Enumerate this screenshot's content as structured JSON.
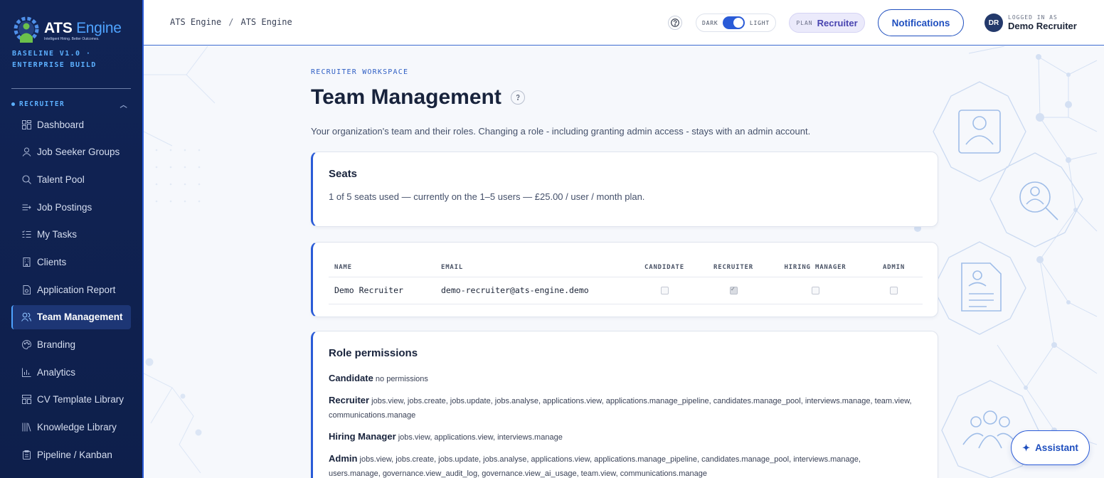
{
  "brand": {
    "name_main": "ATS",
    "name_accent": "Engine",
    "tagline": "Intelligent Hiring. Better Outcomes.",
    "build_line1": "BASELINE V1.0 ·",
    "build_line2": "ENTERPRISE BUILD"
  },
  "sidebar": {
    "section": "RECRUITER",
    "items": [
      {
        "label": "Dashboard",
        "icon": "dashboard-icon"
      },
      {
        "label": "Job Seeker Groups",
        "icon": "user-icon"
      },
      {
        "label": "Talent Pool",
        "icon": "search-icon"
      },
      {
        "label": "Job Postings",
        "icon": "list-arrow-icon"
      },
      {
        "label": "My Tasks",
        "icon": "checklist-icon"
      },
      {
        "label": "Clients",
        "icon": "building-icon"
      },
      {
        "label": "Application Report",
        "icon": "report-icon"
      },
      {
        "label": "Team Management",
        "icon": "team-icon",
        "active": true
      },
      {
        "label": "Branding",
        "icon": "palette-icon"
      },
      {
        "label": "Analytics",
        "icon": "bar-chart-icon"
      },
      {
        "label": "CV Template Library",
        "icon": "template-icon"
      },
      {
        "label": "Knowledge Library",
        "icon": "library-icon"
      },
      {
        "label": "Pipeline / Kanban",
        "icon": "clipboard-icon"
      }
    ]
  },
  "topbar": {
    "breadcrumb": [
      "ATS Engine",
      "ATS Engine"
    ],
    "theme_dark": "DARK",
    "theme_light": "LIGHT",
    "plan_label": "PLAN",
    "plan_value": "Recruiter",
    "notifications": "Notifications",
    "user_initials": "DR",
    "user_caption": "LOGGED IN AS",
    "user_name": "Demo Recruiter"
  },
  "page": {
    "eyebrow": "RECRUITER WORKSPACE",
    "title": "Team Management",
    "subtitle": "Your organization's team and their roles. Changing a role - including granting admin access - stays with an admin account."
  },
  "seats": {
    "title": "Seats",
    "line": "1 of 5 seats used — currently on the 1–5 users — £25.00 / user / month plan."
  },
  "team": {
    "columns": [
      "NAME",
      "EMAIL",
      "CANDIDATE",
      "RECRUITER",
      "HIRING MANAGER",
      "ADMIN"
    ],
    "rows": [
      {
        "name": "Demo Recruiter",
        "email": "demo-recruiter@ats-engine.demo",
        "candidate": false,
        "recruiter": true,
        "hiring_manager": false,
        "admin": false
      }
    ]
  },
  "permissions": {
    "title": "Role permissions",
    "roles": [
      {
        "role": "Candidate",
        "perms": "no permissions"
      },
      {
        "role": "Recruiter",
        "perms": "jobs.view, jobs.create, jobs.update, jobs.analyse, applications.view, applications.manage_pipeline, candidates.manage_pool, interviews.manage, team.view, communications.manage"
      },
      {
        "role": "Hiring Manager",
        "perms": "jobs.view, applications.view, interviews.manage"
      },
      {
        "role": "Admin",
        "perms": "jobs.view, jobs.create, jobs.update, jobs.analyse, applications.view, applications.manage_pipeline, candidates.manage_pool, interviews.manage, users.manage, governance.view_audit_log, governance.view_ai_usage, team.view, communications.manage"
      }
    ]
  },
  "assistant": {
    "label": "Assistant"
  },
  "colors": {
    "accent": "#2a5bd7",
    "sidebar_bg": "#112456",
    "brand_light": "#4fa3ff"
  }
}
